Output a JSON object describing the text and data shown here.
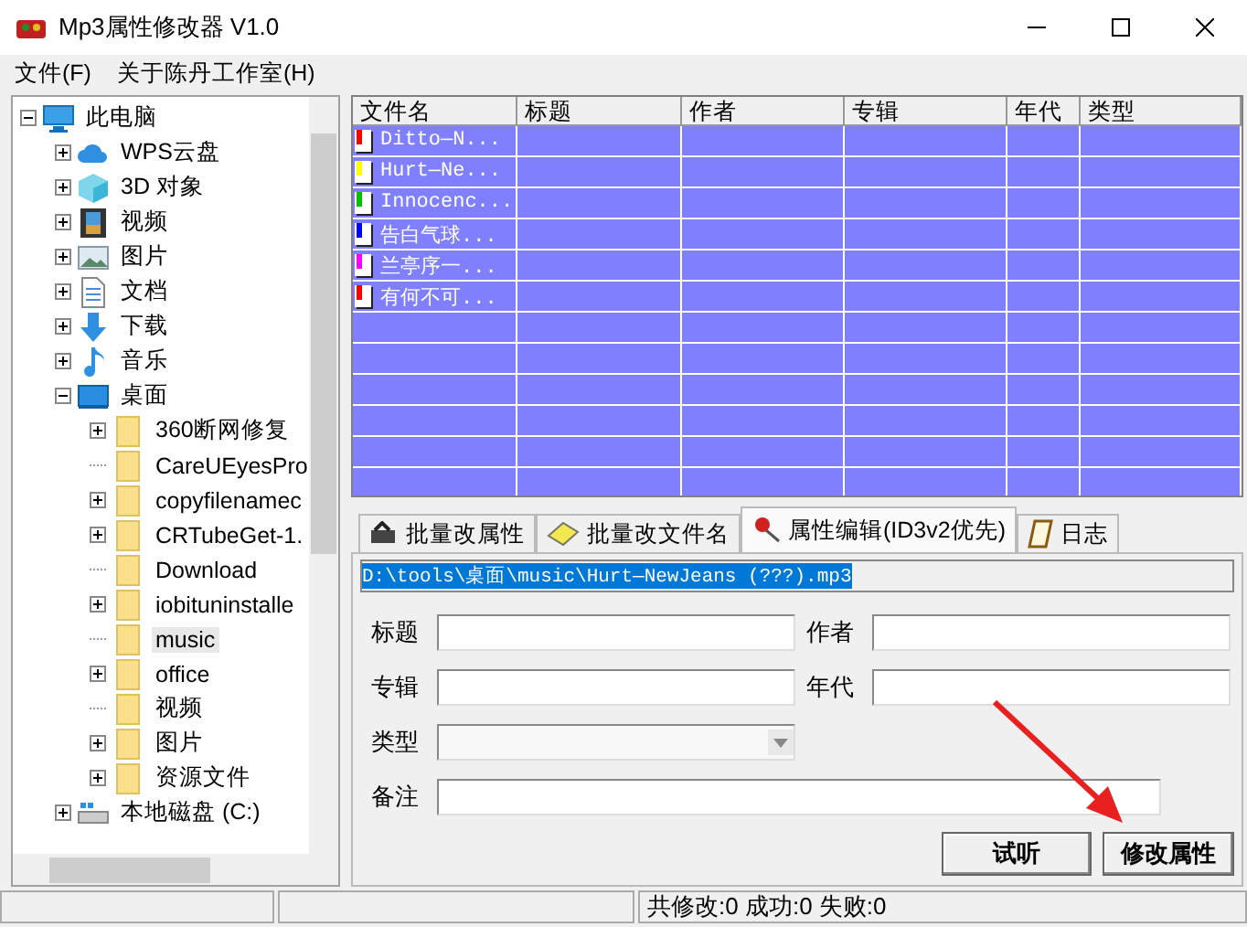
{
  "window": {
    "title": "Mp3属性修改器 V1.0"
  },
  "menu": [
    {
      "label": "文件(F)"
    },
    {
      "label": "关于陈丹工作室(H)"
    }
  ],
  "tree": [
    {
      "label": "此电脑",
      "kind": "pc",
      "expanded": true,
      "selected": false,
      "children": [
        {
          "label": "WPS云盘",
          "kind": "cloud",
          "expanded": false,
          "selected": false
        },
        {
          "label": "3D 对象",
          "kind": "cube",
          "expanded": false,
          "selected": false
        },
        {
          "label": "视频",
          "kind": "video",
          "expanded": false,
          "selected": false
        },
        {
          "label": "图片",
          "kind": "picture",
          "expanded": false,
          "selected": false
        },
        {
          "label": "文档",
          "kind": "document",
          "expanded": false,
          "selected": false
        },
        {
          "label": "下载",
          "kind": "download",
          "expanded": false,
          "selected": false
        },
        {
          "label": "音乐",
          "kind": "music",
          "expanded": false,
          "selected": false
        },
        {
          "label": "桌面",
          "kind": "desktop",
          "expanded": true,
          "selected": false,
          "children": [
            {
              "label": "360断网修复",
              "kind": "folder",
              "expanded": false,
              "selected": false
            },
            {
              "label": "CareUEyesPro",
              "kind": "folder",
              "selected": false
            },
            {
              "label": "copyfilenamec",
              "kind": "folder",
              "expanded": false,
              "selected": false
            },
            {
              "label": "CRTubeGet-1.",
              "kind": "folder",
              "expanded": false,
              "selected": false
            },
            {
              "label": "Download",
              "kind": "folder",
              "selected": false
            },
            {
              "label": "iobituninstalle",
              "kind": "folder",
              "expanded": false,
              "selected": false
            },
            {
              "label": "music",
              "kind": "folder",
              "selected": true
            },
            {
              "label": "office",
              "kind": "folder",
              "expanded": false,
              "selected": false
            },
            {
              "label": "视频",
              "kind": "folder",
              "selected": false
            },
            {
              "label": "图片",
              "kind": "folder",
              "expanded": false,
              "selected": false
            },
            {
              "label": "资源文件",
              "kind": "folder",
              "expanded": false,
              "selected": false
            }
          ]
        },
        {
          "label": "本地磁盘 (C:)",
          "kind": "drive",
          "expanded": false,
          "selected": false
        }
      ]
    }
  ],
  "file_list": {
    "columns": [
      "文件名",
      "标题",
      "作者",
      "专辑",
      "年代",
      "类型"
    ],
    "rows": [
      {
        "name": "Ditto—N...",
        "color": "#ff0000"
      },
      {
        "name": "Hurt—Ne...",
        "color": "#ffff00"
      },
      {
        "name": "Innocenc...",
        "color": "#00c000"
      },
      {
        "name": "告白气球...",
        "color": "#0000ff"
      },
      {
        "name": "兰亭序一...",
        "color": "#ff00ff"
      },
      {
        "name": "有何不可...",
        "color": "#ff0000"
      }
    ]
  },
  "tabs": [
    {
      "label": "批量改属性",
      "selected": false
    },
    {
      "label": "批量改文件名",
      "selected": false
    },
    {
      "label": "属性编辑(ID3v2优先)",
      "selected": true
    },
    {
      "label": "日志",
      "selected": false
    }
  ],
  "path": {
    "value": "D:\\tools\\桌面\\music\\Hurt—NewJeans (???).mp3"
  },
  "fields": [
    {
      "label": "标题",
      "kind": "text"
    },
    {
      "label": "作者",
      "kind": "text"
    },
    {
      "label": "专辑",
      "kind": "text"
    },
    {
      "label": "年代",
      "kind": "text"
    },
    {
      "label": "类型",
      "kind": "combo"
    },
    {
      "label": "备注",
      "kind": "wide"
    }
  ],
  "buttons": [
    {
      "label": "试听"
    },
    {
      "label": "修改属性"
    }
  ],
  "status_bar": {
    "summary": "共修改:0  成功:0  失败:0"
  }
}
